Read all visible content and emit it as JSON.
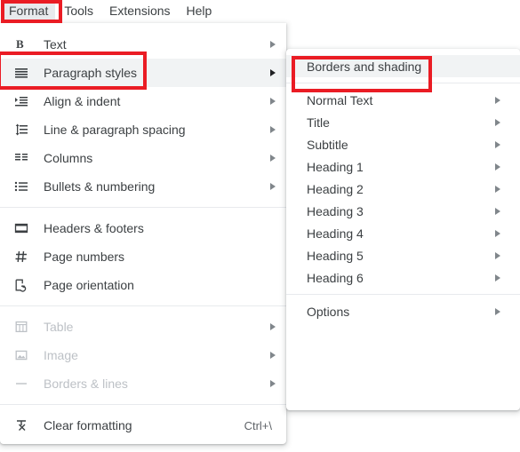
{
  "menubar": {
    "items": [
      {
        "label": "Format",
        "active": true
      },
      {
        "label": "Tools",
        "active": false
      },
      {
        "label": "Extensions",
        "active": false
      },
      {
        "label": "Help",
        "active": false
      }
    ]
  },
  "main_menu": {
    "groups": [
      {
        "items": [
          {
            "label": "Text",
            "icon": "bold-text-icon",
            "submenu": true,
            "disabled": false,
            "hover": false,
            "accel": ""
          },
          {
            "label": "Paragraph styles",
            "icon": "paragraph-styles-icon",
            "submenu": true,
            "disabled": false,
            "hover": true,
            "accel": ""
          },
          {
            "label": "Align & indent",
            "icon": "align-indent-icon",
            "submenu": true,
            "disabled": false,
            "hover": false,
            "accel": ""
          },
          {
            "label": "Line & paragraph spacing",
            "icon": "line-spacing-icon",
            "submenu": true,
            "disabled": false,
            "hover": false,
            "accel": ""
          },
          {
            "label": "Columns",
            "icon": "columns-icon",
            "submenu": true,
            "disabled": false,
            "hover": false,
            "accel": ""
          },
          {
            "label": "Bullets & numbering",
            "icon": "bullets-numbering-icon",
            "submenu": true,
            "disabled": false,
            "hover": false,
            "accel": ""
          }
        ]
      },
      {
        "items": [
          {
            "label": "Headers & footers",
            "icon": "headers-footers-icon",
            "submenu": false,
            "disabled": false,
            "hover": false,
            "accel": ""
          },
          {
            "label": "Page numbers",
            "icon": "page-numbers-icon",
            "submenu": false,
            "disabled": false,
            "hover": false,
            "accel": ""
          },
          {
            "label": "Page orientation",
            "icon": "page-orientation-icon",
            "submenu": false,
            "disabled": false,
            "hover": false,
            "accel": ""
          }
        ]
      },
      {
        "items": [
          {
            "label": "Table",
            "icon": "table-icon",
            "submenu": true,
            "disabled": true,
            "hover": false,
            "accel": ""
          },
          {
            "label": "Image",
            "icon": "image-icon",
            "submenu": true,
            "disabled": true,
            "hover": false,
            "accel": ""
          },
          {
            "label": "Borders & lines",
            "icon": "borders-lines-icon",
            "submenu": true,
            "disabled": true,
            "hover": false,
            "accel": ""
          }
        ]
      },
      {
        "items": [
          {
            "label": "Clear formatting",
            "icon": "clear-formatting-icon",
            "submenu": false,
            "disabled": false,
            "hover": false,
            "accel": "Ctrl+\\"
          }
        ]
      }
    ]
  },
  "submenu": {
    "groups": [
      {
        "items": [
          {
            "label": "Borders and shading",
            "submenu": false,
            "hover": true
          }
        ]
      },
      {
        "items": [
          {
            "label": "Normal Text",
            "submenu": true,
            "hover": false
          },
          {
            "label": "Title",
            "submenu": true,
            "hover": false
          },
          {
            "label": "Subtitle",
            "submenu": true,
            "hover": false
          },
          {
            "label": "Heading 1",
            "submenu": true,
            "hover": false
          },
          {
            "label": "Heading 2",
            "submenu": true,
            "hover": false
          },
          {
            "label": "Heading 3",
            "submenu": true,
            "hover": false
          },
          {
            "label": "Heading 4",
            "submenu": true,
            "hover": false
          },
          {
            "label": "Heading 5",
            "submenu": true,
            "hover": false
          },
          {
            "label": "Heading 6",
            "submenu": true,
            "hover": false
          }
        ]
      },
      {
        "items": [
          {
            "label": "Options",
            "submenu": true,
            "hover": false
          }
        ]
      }
    ]
  },
  "annotations": {
    "boxes": [
      {
        "target": "Format",
        "color": "#ea1c24"
      },
      {
        "target": "Paragraph styles",
        "color": "#ea1c24"
      },
      {
        "target": "Borders and shading",
        "color": "#ea1c24"
      }
    ]
  }
}
